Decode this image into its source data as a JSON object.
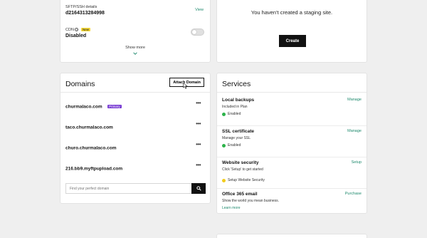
{
  "top_left": {
    "sftp_label": "SFTP/SSH details",
    "sftp_value": "d2164313284998",
    "sftp_link": "View",
    "cdn_label": "CDN",
    "cdn_badge": "New",
    "cdn_value": "Disabled",
    "show_more": "Show more"
  },
  "staging": {
    "message": "You haven't created a staging site.",
    "create_label": "Create"
  },
  "domains": {
    "title": "Domains",
    "attach_label": "Attach Domain",
    "items": [
      {
        "name": "churmalaco.com",
        "badge": "Primary"
      },
      {
        "name": "taco.churmalaco.com"
      },
      {
        "name": "churo.churmalaco.com"
      },
      {
        "name": "216.bb9.myftpupload.com"
      }
    ],
    "more_glyph": "•••",
    "search_placeholder": "Find your perfect domain"
  },
  "services": {
    "title": "Services",
    "items": [
      {
        "title": "Local backups",
        "subtitle": "Included in Plan",
        "status": "Enabled",
        "action": "Manage"
      },
      {
        "title": "SSL certificate",
        "subtitle": "Manage your SSL",
        "status": "Enabled",
        "action": "Manage"
      },
      {
        "title": "Website security",
        "subtitle": "Click 'Setup' to get started",
        "status": "Setup Website Security",
        "action": "Setup"
      },
      {
        "title": "Office 365 email",
        "subtitle": "Show the world you mean business.",
        "link": "Learn more",
        "action": "Purchase"
      }
    ]
  },
  "colors": {
    "accent_link": "#1f8a6e",
    "status_enabled": "#2db34a",
    "status_warning": "#f2cc1d",
    "primary_badge": "#7b3fd4",
    "new_badge": "#f5d83a"
  }
}
